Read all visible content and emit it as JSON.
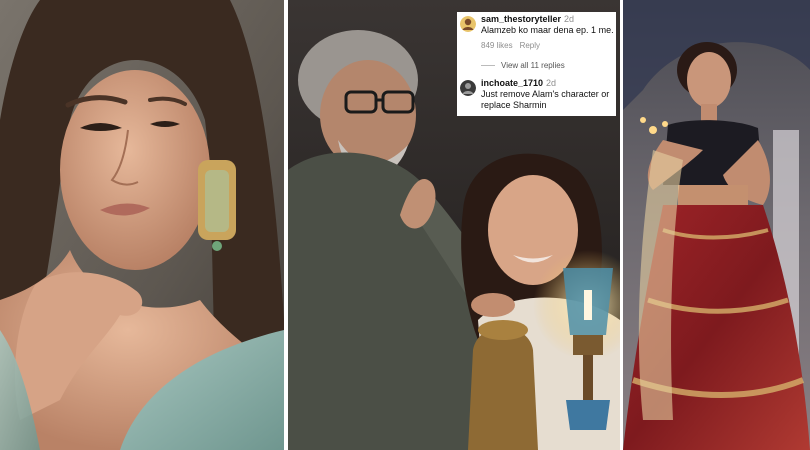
{
  "comments": [
    {
      "username": "sam_thestoryteller",
      "time": "2d",
      "text": "Alamzeb ko maar dena ep. 1 me.",
      "likes": "849 likes",
      "reply": "Reply"
    },
    {
      "username": "inchoate_1710",
      "time": "2d",
      "text": "Just remove Alam's character or replace Sharmin"
    }
  ],
  "view_replies": "View all 11 replies",
  "colors": {
    "divider": "#ffffff",
    "comment_bg": "#ffffff",
    "meta_text": "#8e8e8e",
    "lehenga_red": "#8e1a20",
    "teal_outfit": "#8fb3ad"
  }
}
